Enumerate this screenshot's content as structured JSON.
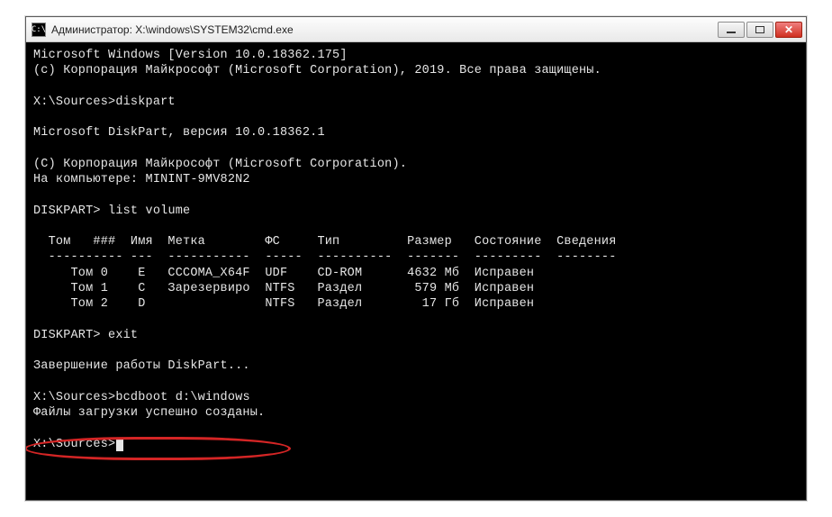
{
  "window": {
    "title": "Администратор: X:\\windows\\SYSTEM32\\cmd.exe",
    "icon_text": "C:\\"
  },
  "term": {
    "line_ms_win": "Microsoft Windows [Version 10.0.18362.175]",
    "line_copyright": "(c) Корпорация Майкрософт (Microsoft Corporation), 2019. Все права защищены.",
    "prompt1": "X:\\Sources>",
    "cmd1": "diskpart",
    "dp_version": "Microsoft DiskPart, версия 10.0.18362.1",
    "dp_copyright": "(C) Корпорация Майкрософт (Microsoft Corporation).",
    "dp_computer": "На компьютере: MININT-9MV82N2",
    "dp_prompt1": "DISKPART>",
    "dp_cmd1": "list volume",
    "vol_header": "  Том   ###  Имя  Метка        ФС     Тип         Размер   Состояние  Сведения",
    "vol_divider": "  ---------- ---  -----------  -----  ----------  -------  ---------  --------",
    "vol_row0": "     Том 0    E   CCCOMA_X64F  UDF    CD-ROM      4632 Мб  Исправен",
    "vol_row1": "     Том 1    C   Зарезервиро  NTFS   Раздел       579 Мб  Исправен",
    "vol_row2": "     Том 2    D                NTFS   Раздел        17 Гб  Исправен",
    "dp_prompt2": "DISKPART>",
    "dp_cmd2": "exit",
    "dp_exit_msg": "Завершение работы DiskPart...",
    "prompt2": "X:\\Sources>",
    "cmd2": "bcdboot d:\\windows",
    "bcd_result": "Файлы загрузки успешно созданы.",
    "prompt3": "X:\\Sources>"
  }
}
